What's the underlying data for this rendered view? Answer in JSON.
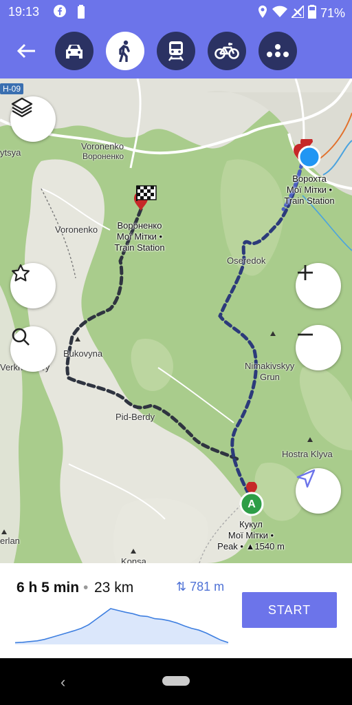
{
  "status_bar": {
    "time": "19:13",
    "battery": "71%"
  },
  "modes": [
    {
      "name": "car",
      "active": false
    },
    {
      "name": "walk",
      "active": true
    },
    {
      "name": "train",
      "active": false
    },
    {
      "name": "bike",
      "active": false
    },
    {
      "name": "more",
      "active": false
    }
  ],
  "map": {
    "road_badge": "H-09",
    "labels": {
      "voronenko_top": "Voronenko",
      "voronenko_top_cyr": "Вороненко",
      "voronenko_left": "Voronenko",
      "ytsya": "ytsya",
      "osered": "Oseredok",
      "bukovyna": "Bukovyna",
      "verkh": "Verkh-Debry",
      "pidberdy": "Pid-Berdy",
      "nimak1": "Nimakivskyy",
      "nimak2": "Grun",
      "hostra": "Hostra Klyva",
      "erlan": "erlan",
      "konsa": "Konsa"
    },
    "pois": {
      "finish": {
        "line1": "Вороненко",
        "line2": "Мої Мітки •",
        "line3": "Train Station"
      },
      "current": {
        "line1": "Ворохта",
        "line2": "Мої Мітки •",
        "line3": "Train Station"
      },
      "start": {
        "marker": "A",
        "line1": "Кукул",
        "line2": "Мої Мітки •",
        "line3": "Peak • ▲1540 m"
      }
    }
  },
  "route": {
    "duration": "6 h 5 min",
    "separator": "•",
    "distance": "23 km",
    "climb_label": "781 m",
    "elevation_profile": [
      0.05,
      0.06,
      0.08,
      0.1,
      0.14,
      0.2,
      0.26,
      0.32,
      0.38,
      0.45,
      0.55,
      0.7,
      0.85,
      1.0,
      0.95,
      0.9,
      0.86,
      0.8,
      0.78,
      0.72,
      0.7,
      0.66,
      0.6,
      0.52,
      0.45,
      0.4,
      0.32,
      0.22,
      0.12,
      0.05
    ]
  },
  "start_button": "START",
  "colors": {
    "accent": "#6c74ea",
    "route": "#2c3a7a",
    "route_dark": "#2f3440",
    "current": "#2196f3",
    "marker_red": "#d32f2f",
    "marker_green": "#2e9e47"
  }
}
